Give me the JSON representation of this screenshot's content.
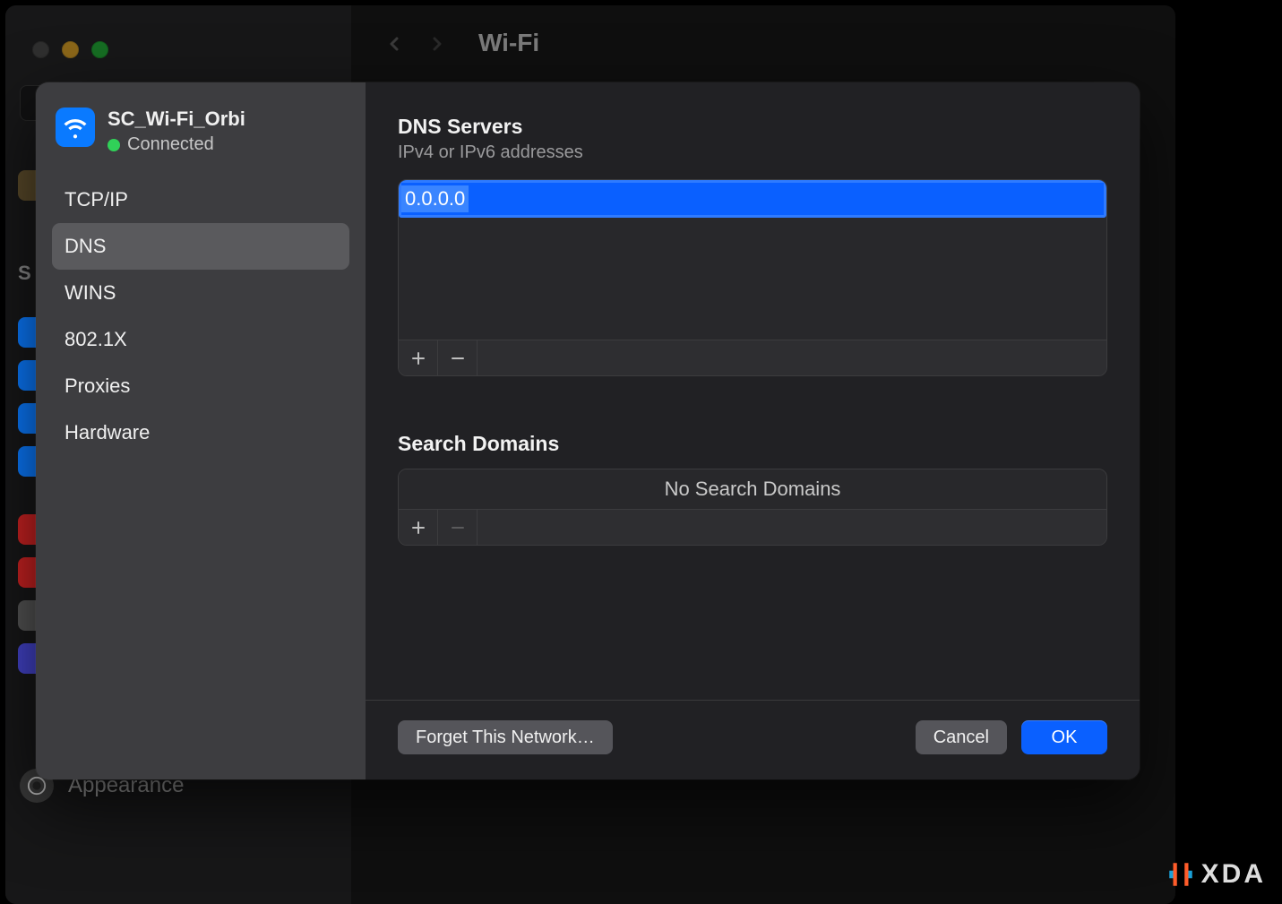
{
  "bg_window": {
    "title": "Wi-Fi",
    "sidebar_bottom_label": "Appearance"
  },
  "sheet": {
    "network": {
      "name": "SC_Wi-Fi_Orbi",
      "status_label": "Connected"
    },
    "tabs": [
      {
        "label": "TCP/IP",
        "active": false
      },
      {
        "label": "DNS",
        "active": true
      },
      {
        "label": "WINS",
        "active": false
      },
      {
        "label": "802.1X",
        "active": false
      },
      {
        "label": "Proxies",
        "active": false
      },
      {
        "label": "Hardware",
        "active": false
      }
    ],
    "dns_section": {
      "title": "DNS Servers",
      "subtitle": "IPv4 or IPv6 addresses",
      "entries": [
        {
          "value": "0.0.0.0",
          "selected": true
        }
      ]
    },
    "search_section": {
      "title": "Search Domains",
      "empty_label": "No Search Domains"
    },
    "footer": {
      "forget_label": "Forget This Network…",
      "cancel_label": "Cancel",
      "ok_label": "OK"
    }
  },
  "watermark": "XDA"
}
